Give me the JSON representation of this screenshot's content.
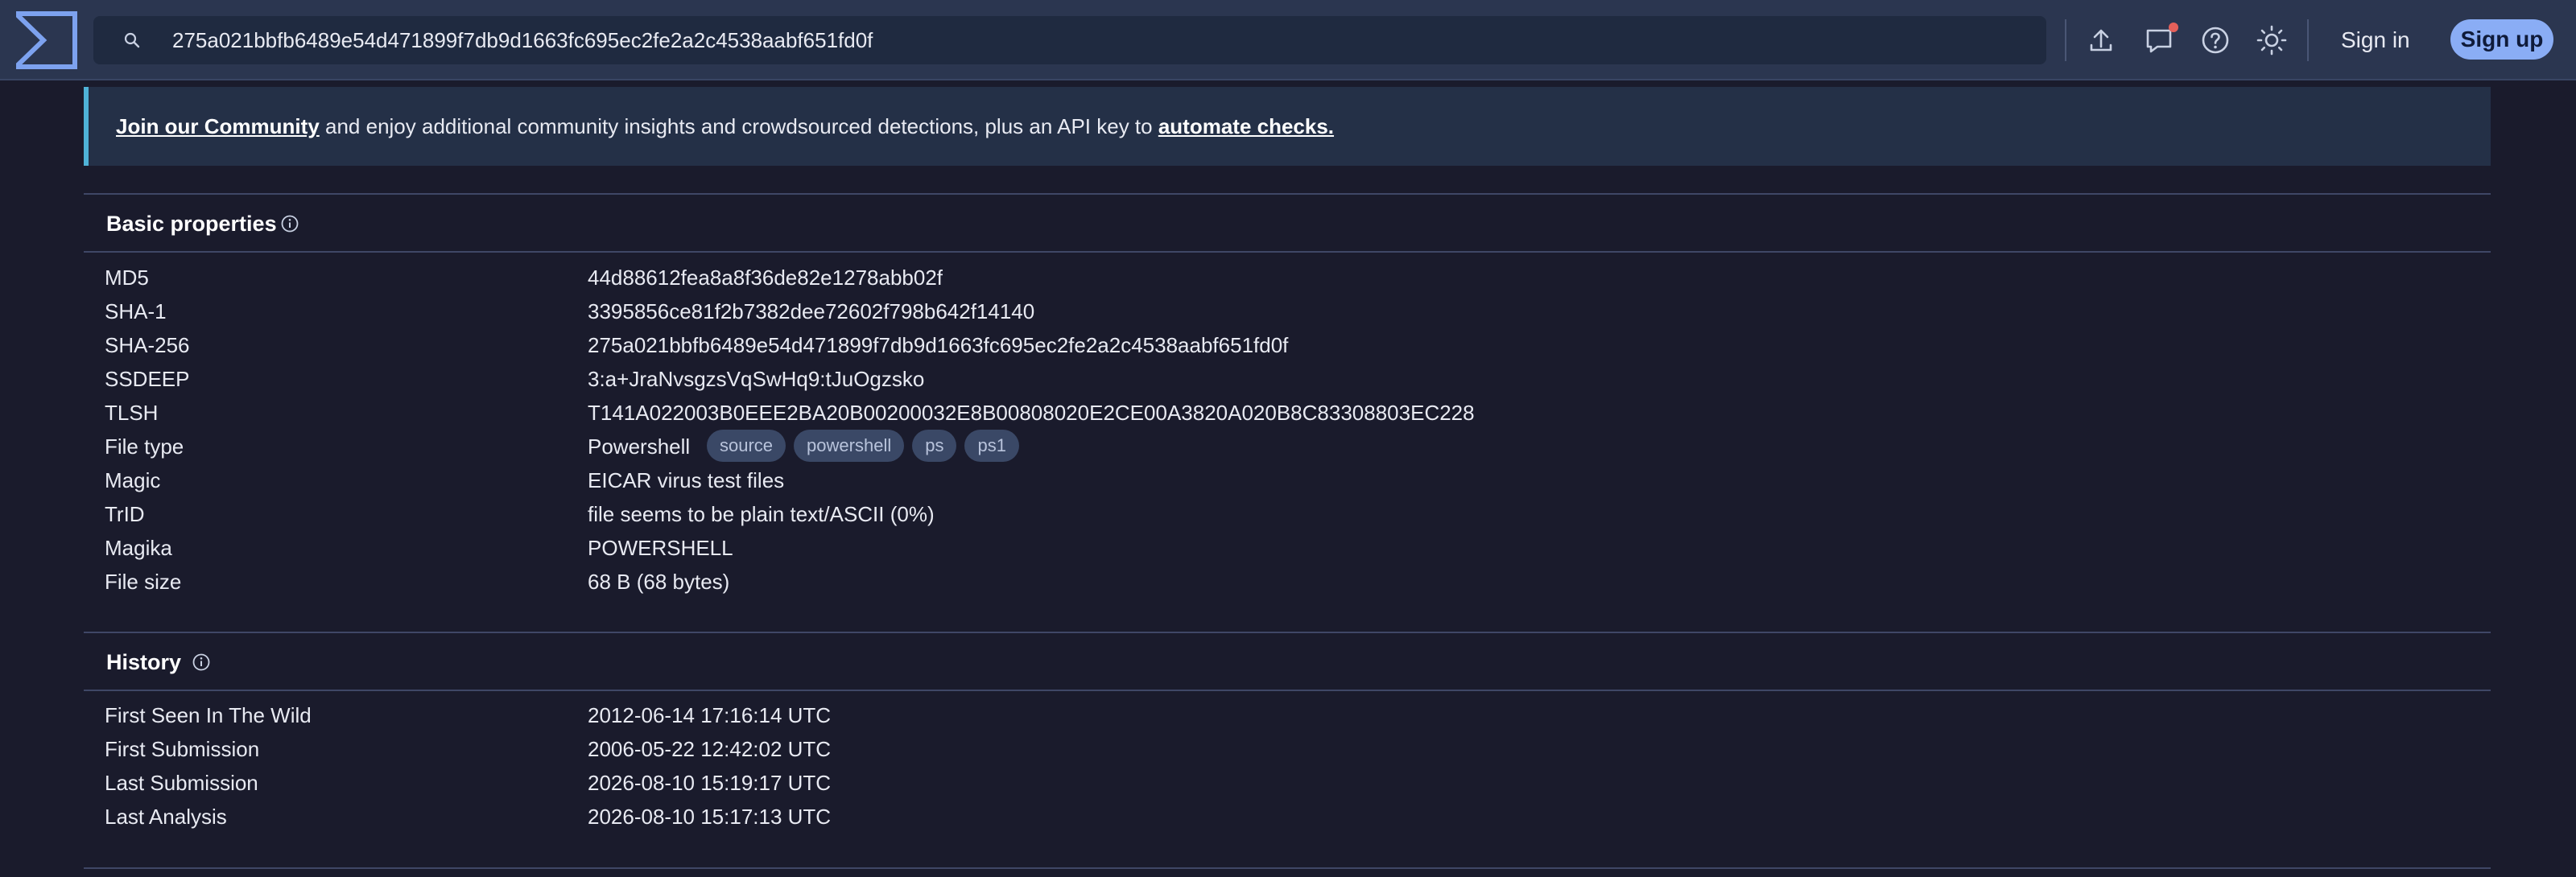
{
  "search": {
    "value": "275a021bbfb6489e54d471899f7db9d1663fc695ec2fe2a2c4538aabf651fd0f"
  },
  "header": {
    "sign_in": "Sign in",
    "sign_up": "Sign up"
  },
  "banner": {
    "link1": "Join our Community",
    "text": " and enjoy additional community insights and crowdsourced detections, plus an API key to ",
    "link2": "automate checks."
  },
  "basic_properties": {
    "title": "Basic properties",
    "rows": [
      {
        "key": "MD5",
        "value": "44d88612fea8a8f36de82e1278abb02f"
      },
      {
        "key": "SHA-1",
        "value": "3395856ce81f2b7382dee72602f798b642f14140"
      },
      {
        "key": "SHA-256",
        "value": "275a021bbfb6489e54d471899f7db9d1663fc695ec2fe2a2c4538aabf651fd0f"
      },
      {
        "key": "SSDEEP",
        "value": "3:a+JraNvsgzsVqSwHq9:tJuOgzsko"
      },
      {
        "key": "TLSH",
        "value": "T141A022003B0EEE2BA20B00200032E8B00808020E2CE00A3820A020B8C83308803EC228"
      },
      {
        "key": "File type",
        "value": "Powershell",
        "tags": [
          "source",
          "powershell",
          "ps",
          "ps1"
        ]
      },
      {
        "key": "Magic",
        "value": "EICAR virus test files"
      },
      {
        "key": "TrID",
        "value": "file seems to be plain text/ASCII (0%)"
      },
      {
        "key": "Magika",
        "value": "POWERSHELL"
      },
      {
        "key": "File size",
        "value": "68 B (68 bytes)"
      }
    ]
  },
  "history": {
    "title": "History",
    "rows": [
      {
        "key": "First Seen In The Wild",
        "value": "2012-06-14 17:16:14 UTC"
      },
      {
        "key": "First Submission",
        "value": "2006-05-22 12:42:02 UTC"
      },
      {
        "key": "Last Submission",
        "value": "2026-08-10 15:19:17 UTC"
      },
      {
        "key": "Last Analysis",
        "value": "2026-08-10 15:17:13 UTC"
      }
    ]
  }
}
